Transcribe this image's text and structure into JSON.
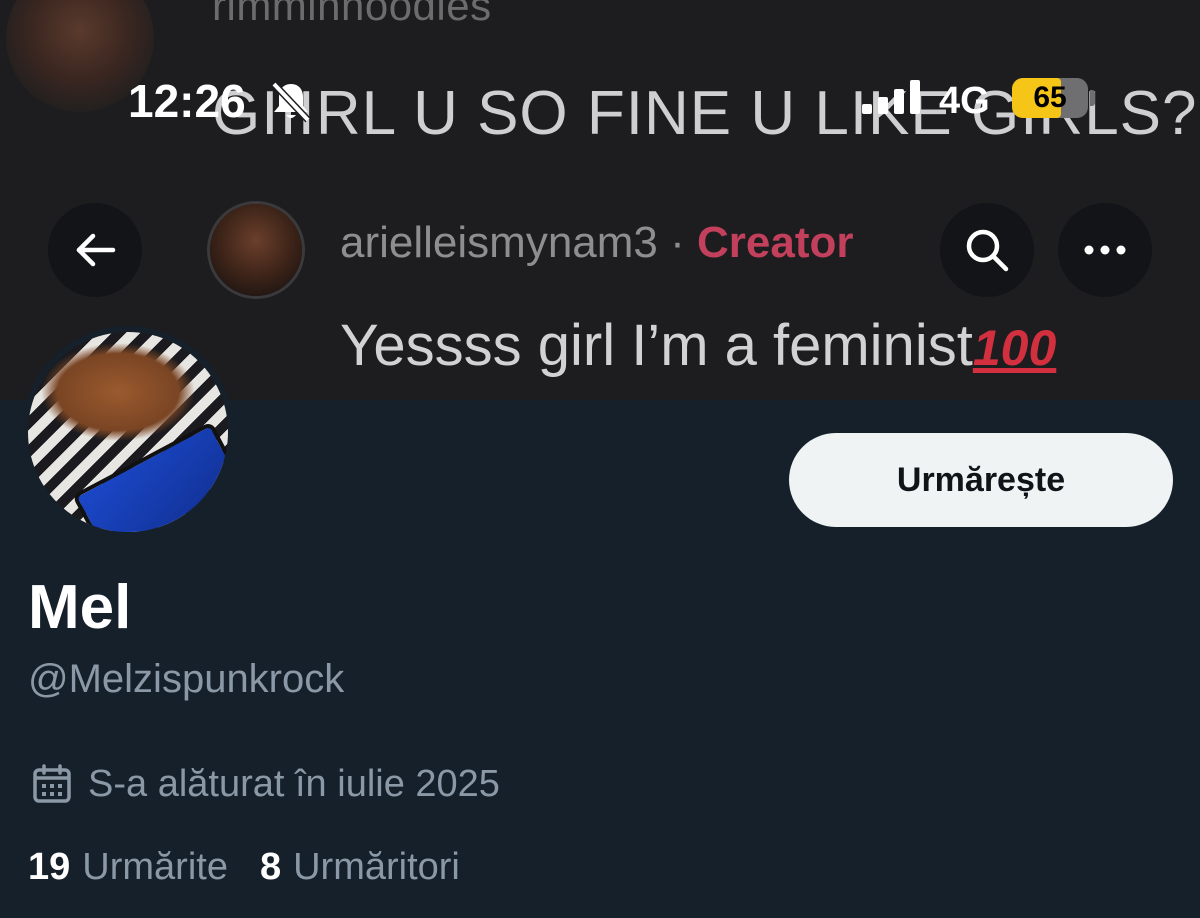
{
  "status_bar": {
    "time": "12:26",
    "network": "4G",
    "battery_level": "65",
    "battery_fraction": 0.65,
    "battery_color": "#f5c518"
  },
  "banner": {
    "top_username": "rimminnoodles",
    "comment_text": "GIIIRL U SO FINE U LIKE GIRLS?",
    "creator_username": "arielleismynam3",
    "creator_separator": " · ",
    "creator_tag": "Creator",
    "reply_text": "Yessss girl I’m a feminist",
    "reply_emoji": "100"
  },
  "header_buttons": {
    "back_icon": "arrow-left-icon",
    "search_icon": "search-icon",
    "more_icon": "more-horizontal-icon"
  },
  "profile": {
    "follow_label": "Urmărește",
    "display_name": "Mel",
    "handle": "@Melzispunkrock",
    "joined": "S-a alăturat în iulie 2025",
    "following_count": "19",
    "following_label": "Urmărite",
    "followers_count": "8",
    "followers_label": "Urmăritori"
  },
  "colors": {
    "background": "#15202b",
    "secondary_text": "#8b98a5",
    "follow_button_bg": "#eff3f4",
    "creator_tag": "#c2405b"
  }
}
